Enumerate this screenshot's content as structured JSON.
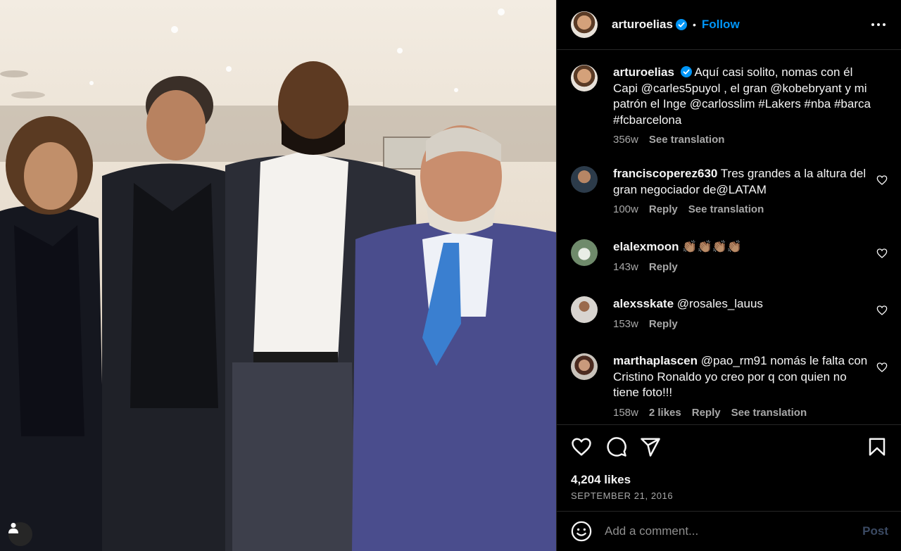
{
  "header": {
    "username": "arturoelias",
    "follow_label": "Follow",
    "separator": "•"
  },
  "caption": {
    "username": "arturoelias",
    "text": "Aquí casi solito, nomas con él Capi @carles5puyol , el gran @kobebryant y mi patrón el Inge @carlosslim #Lakers #nba #barca #fcbarcelona",
    "time": "356w",
    "translation_label": "See translation"
  },
  "comments": [
    {
      "username": "franciscoperez630",
      "text": "Tres grandes a la altura del gran negociador de@LATAM",
      "time": "100w",
      "likes": "",
      "reply_label": "Reply",
      "translation_label": "See translation"
    },
    {
      "username": "elalexmoon",
      "text": "👏🏽👏🏽👏🏽👏🏽",
      "time": "143w",
      "likes": "",
      "reply_label": "Reply",
      "translation_label": ""
    },
    {
      "username": "alexsskate",
      "text": "@rosales_lauus",
      "time": "153w",
      "likes": "",
      "reply_label": "Reply",
      "translation_label": ""
    },
    {
      "username": "marthaplascen",
      "text": "@pao_rm91 nomás le falta con Cristino Ronaldo yo creo por q con quien no tiene foto!!!",
      "time": "158w",
      "likes": "2 likes",
      "reply_label": "Reply",
      "translation_label": "See translation"
    }
  ],
  "stats": {
    "likes": "4,204 likes",
    "date": "SEPTEMBER 21, 2016"
  },
  "composer": {
    "placeholder": "Add a comment...",
    "post_label": "Post"
  },
  "icons": {
    "like": "heart-icon",
    "comment": "comment-icon",
    "share": "share-icon",
    "save": "bookmark-icon",
    "options": "more-options-icon",
    "emoji": "emoji-icon",
    "tagged": "user-tag-icon"
  },
  "colors": {
    "accent": "#0095f6",
    "background": "#000000",
    "muted_text": "#a8a8a8",
    "divider": "#262626"
  }
}
